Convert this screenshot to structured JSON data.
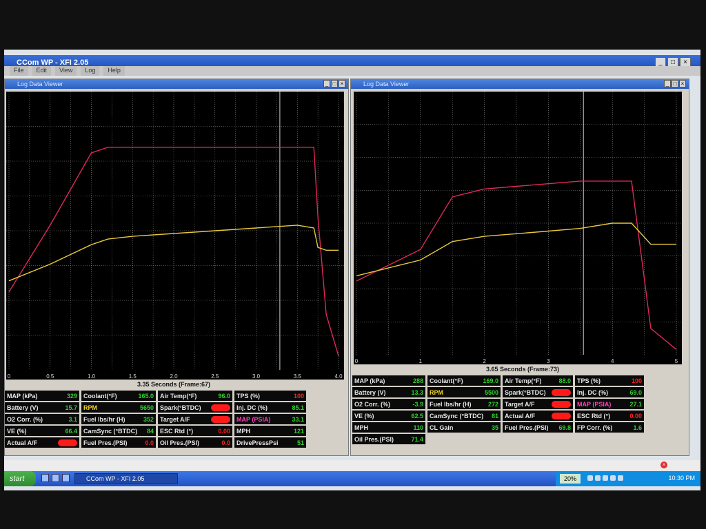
{
  "app": {
    "title": "CCom WP - XFI 2.05",
    "menu": [
      "File",
      "Edit",
      "View",
      "Log",
      "Help"
    ]
  },
  "left": {
    "title": "Log Data Viewer",
    "time_label": "3.35 Seconds (Frame:67)",
    "x_ticks": [
      "0",
      "0.5",
      "1.0",
      "1.5",
      "2.0",
      "2.5",
      "3.0",
      "3.5",
      "4.0"
    ],
    "params": [
      {
        "label": "MAP (kPa)",
        "value": "329"
      },
      {
        "label": "Coolant(°F)",
        "value": "165.0"
      },
      {
        "label": "Air Temp(°F)",
        "value": "96.0"
      },
      {
        "label": "TPS (%)",
        "value": "100",
        "red": true
      },
      {
        "label": "Battery (V)",
        "value": "15.7"
      },
      {
        "label": "RPM",
        "value": "5650",
        "yellow": true
      },
      {
        "label": "Spark(°BTDC)",
        "value": "",
        "redact": true
      },
      {
        "label": "Inj. DC (%)",
        "value": "85.1"
      },
      {
        "label": "O2 Corr. (%)",
        "value": "3.1"
      },
      {
        "label": "Fuel lbs/hr (H)",
        "value": "352"
      },
      {
        "label": "Target A/F",
        "value": "",
        "redact": true
      },
      {
        "label": "MAP (PSIA)",
        "value": "33.1",
        "magenta": true
      },
      {
        "label": "VE (%)",
        "value": "66.4"
      },
      {
        "label": "CamSync (°BTDC)",
        "value": "84"
      },
      {
        "label": "ESC Rtd (°)",
        "value": "0.00",
        "red": true
      },
      {
        "label": "MPH",
        "value": "121"
      },
      {
        "label": "Actual A/F",
        "value": "",
        "redact": true
      },
      {
        "label": "Fuel Pres.(PSI)",
        "value": "0.0",
        "red": true
      },
      {
        "label": "Oil Pres.(PSI)",
        "value": "0.0",
        "red": true
      },
      {
        "label": "DrivePressPsi",
        "value": "51"
      }
    ]
  },
  "right": {
    "title": "Log Data Viewer",
    "time_label": "3.65 Seconds (Frame:73)",
    "x_ticks": [
      "0",
      "1",
      "2",
      "3",
      "4",
      "5"
    ],
    "params": [
      {
        "label": "MAP (kPa)",
        "value": "288"
      },
      {
        "label": "Coolant(°F)",
        "value": "169.0"
      },
      {
        "label": "Air Temp(°F)",
        "value": "88.0"
      },
      {
        "label": "TPS (%)",
        "value": "100",
        "red": true
      },
      {
        "label": "Battery (V)",
        "value": "13.3"
      },
      {
        "label": "RPM",
        "value": "5500",
        "yellow": true
      },
      {
        "label": "Spark(°BTDC)",
        "value": "",
        "redact": true
      },
      {
        "label": "Inj. DC (%)",
        "value": "69.0"
      },
      {
        "label": "O2 Corr. (%)",
        "value": "-3.9"
      },
      {
        "label": "Fuel lbs/hr (H)",
        "value": "272"
      },
      {
        "label": "Target A/F",
        "value": "",
        "redact": true
      },
      {
        "label": "MAP (PSIA)",
        "value": "27.1",
        "magenta": true
      },
      {
        "label": "VE (%)",
        "value": "62.5"
      },
      {
        "label": "CamSync (°BTDC)",
        "value": "81"
      },
      {
        "label": "Actual A/F",
        "value": "",
        "redact": true
      },
      {
        "label": "ESC Rtd (°)",
        "value": "0.00",
        "red": true
      },
      {
        "label": "MPH",
        "value": "110"
      },
      {
        "label": "CL Gain",
        "value": "35"
      },
      {
        "label": "Fuel Pres.(PSI)",
        "value": "69.8"
      },
      {
        "label": "FP Corr. (%)",
        "value": "1.6"
      },
      {
        "label": "Oil Pres.(PSI)",
        "value": "71.4"
      }
    ]
  },
  "taskbar": {
    "start": "start",
    "task": "CCom WP - XFI 2.05",
    "battery": "20%",
    "clock": "10:30 PM"
  },
  "colors": {
    "red_trace": "#e0285a",
    "yellow_trace": "#e8c83a",
    "grid": "#9a9a9a"
  },
  "chart_data": [
    {
      "type": "line",
      "x": [
        0,
        0.5,
        1.0,
        1.2,
        1.5,
        2.0,
        2.5,
        3.0,
        3.5,
        3.7,
        3.75,
        3.85,
        4.0
      ],
      "series": [
        {
          "values": [
            0.28,
            0.52,
            0.78,
            0.8,
            0.8,
            0.8,
            0.8,
            0.8,
            0.8,
            0.8,
            0.55,
            0.2,
            0.05
          ]
        },
        {
          "values": [
            0.32,
            0.38,
            0.45,
            0.47,
            0.48,
            0.49,
            0.5,
            0.51,
            0.52,
            0.51,
            0.44,
            0.43,
            0.43
          ]
        }
      ],
      "xlim": [
        0,
        4.0
      ]
    },
    {
      "type": "line",
      "x": [
        0,
        1,
        1.5,
        2,
        2.5,
        3,
        3.5,
        4,
        4.3,
        4.6,
        5
      ],
      "series": [
        {
          "values": [
            0.28,
            0.4,
            0.6,
            0.63,
            0.64,
            0.65,
            0.66,
            0.66,
            0.66,
            0.1,
            0.02
          ]
        },
        {
          "values": [
            0.3,
            0.36,
            0.43,
            0.45,
            0.46,
            0.47,
            0.48,
            0.5,
            0.5,
            0.42,
            0.42
          ]
        }
      ],
      "xlim": [
        0,
        5
      ]
    }
  ]
}
